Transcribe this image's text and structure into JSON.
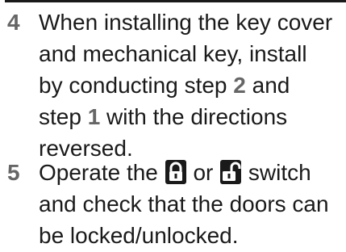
{
  "steps": [
    {
      "number": "4",
      "lines": [
        "When installing the key cover",
        "and mechanical key, install",
        [
          "by conducting step ",
          "2",
          " and"
        ],
        [
          "step ",
          "1",
          " with the directions"
        ],
        "reversed."
      ]
    },
    {
      "number": "5",
      "line1_a": "Operate the",
      "line1_or": "or",
      "line1_b": "switch",
      "line2": "and check that the doors can",
      "line3": "be locked/unlocked.",
      "icons": [
        "lock-closed-icon",
        "lock-open-icon"
      ]
    }
  ],
  "colors": {
    "step_number": "#666666",
    "text": "#1a1a1a"
  }
}
